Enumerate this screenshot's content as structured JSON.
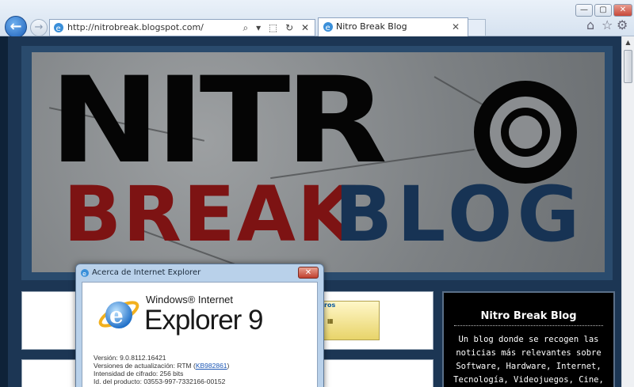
{
  "browser": {
    "address_url": "http://nitrobreak.blogspot.com/",
    "address_tools": "⌕ ▾ ⬚ ↻ ✕",
    "tab_title": "Nitro Break Blog",
    "tab_close": "✕",
    "back": "←",
    "forward": "→",
    "win_min": "—",
    "win_max": "▢",
    "win_close": "✕",
    "home_icon": "⌂",
    "favorites_icon": "☆",
    "tools_icon": "⚙"
  },
  "page": {
    "banner": {
      "line1": "NITR",
      "line2a": "BREAK",
      "line2b": "BLOG"
    },
    "ad_label": "ros",
    "sidebar": {
      "title": "Nitro Break Blog",
      "text": "Un blog donde se recogen las noticias más relevantes sobre Software, Hardware, Internet, Tecnología, Videojuegos, Cine, y mucho más."
    }
  },
  "dialog": {
    "title": "Acerca de Internet Explorer",
    "close": "✕",
    "brand_top": "Windows® Internet",
    "brand_main": "Explorer 9",
    "version": "Versión: 9.0.8112.16421",
    "updates_prefix": "Versiones de actualización: RTM (",
    "updates_link": "KB982861",
    "updates_suffix": ")",
    "cipher": "Intensidad de cifrado: 256 bits",
    "product_id": "Id. del producto: 03553-997-7332166-00152"
  }
}
